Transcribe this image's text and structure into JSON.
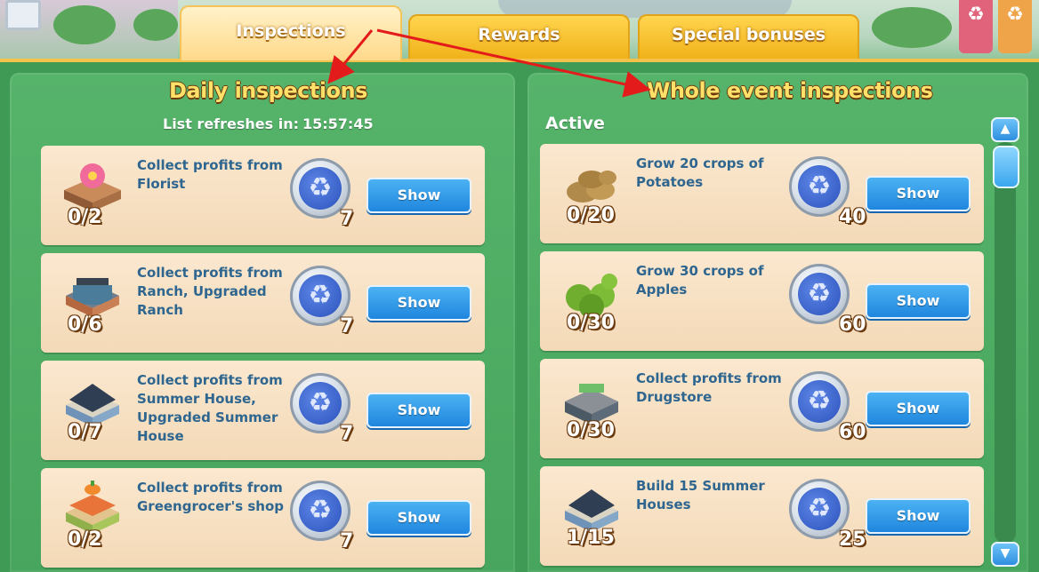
{
  "tabs": {
    "inspections": "Inspections",
    "rewards": "Rewards",
    "special_bonuses": "Special bonuses"
  },
  "daily": {
    "title": "Daily inspections",
    "refresh_label": "List refreshes in:",
    "refresh_time": "15:57:45",
    "cards": [
      {
        "progress": "0/2",
        "desc": "Collect profits from Florist",
        "reward": "7",
        "button": "Show",
        "thumb": "florist-building-icon"
      },
      {
        "progress": "0/6",
        "desc": "Collect profits from Ranch, Upgraded Ranch",
        "reward": "7",
        "button": "Show",
        "thumb": "ranch-building-icon"
      },
      {
        "progress": "0/7",
        "desc": "Collect profits from Summer House, Upgraded Summer House",
        "reward": "7",
        "button": "Show",
        "thumb": "summer-house-icon"
      },
      {
        "progress": "0/2",
        "desc": "Collect profits from Greengrocer's shop",
        "reward": "7",
        "button": "Show",
        "thumb": "greengrocer-shop-icon"
      }
    ]
  },
  "event": {
    "title": "Whole event inspections",
    "active_label": "Active",
    "cards": [
      {
        "progress": "0/20",
        "desc": "Grow 20 crops of Potatoes",
        "reward": "40",
        "button": "Show",
        "thumb": "potatoes-icon"
      },
      {
        "progress": "0/30",
        "desc": "Grow 30 crops of Apples",
        "reward": "60",
        "button": "Show",
        "thumb": "apples-icon"
      },
      {
        "progress": "0/30",
        "desc": "Collect profits from Drugstore",
        "reward": "60",
        "button": "Show",
        "thumb": "drugstore-building-icon"
      },
      {
        "progress": "1/15",
        "desc": "Build 15 Summer Houses",
        "reward": "25",
        "button": "Show",
        "thumb": "summer-house-icon"
      }
    ]
  },
  "colors": {
    "panel_green": "#4aa95f",
    "card_bg": "#f6dfbf",
    "button_blue": "#2a94e4",
    "title_yellow": "#ffe169",
    "annotation_red": "#e31b1b"
  }
}
